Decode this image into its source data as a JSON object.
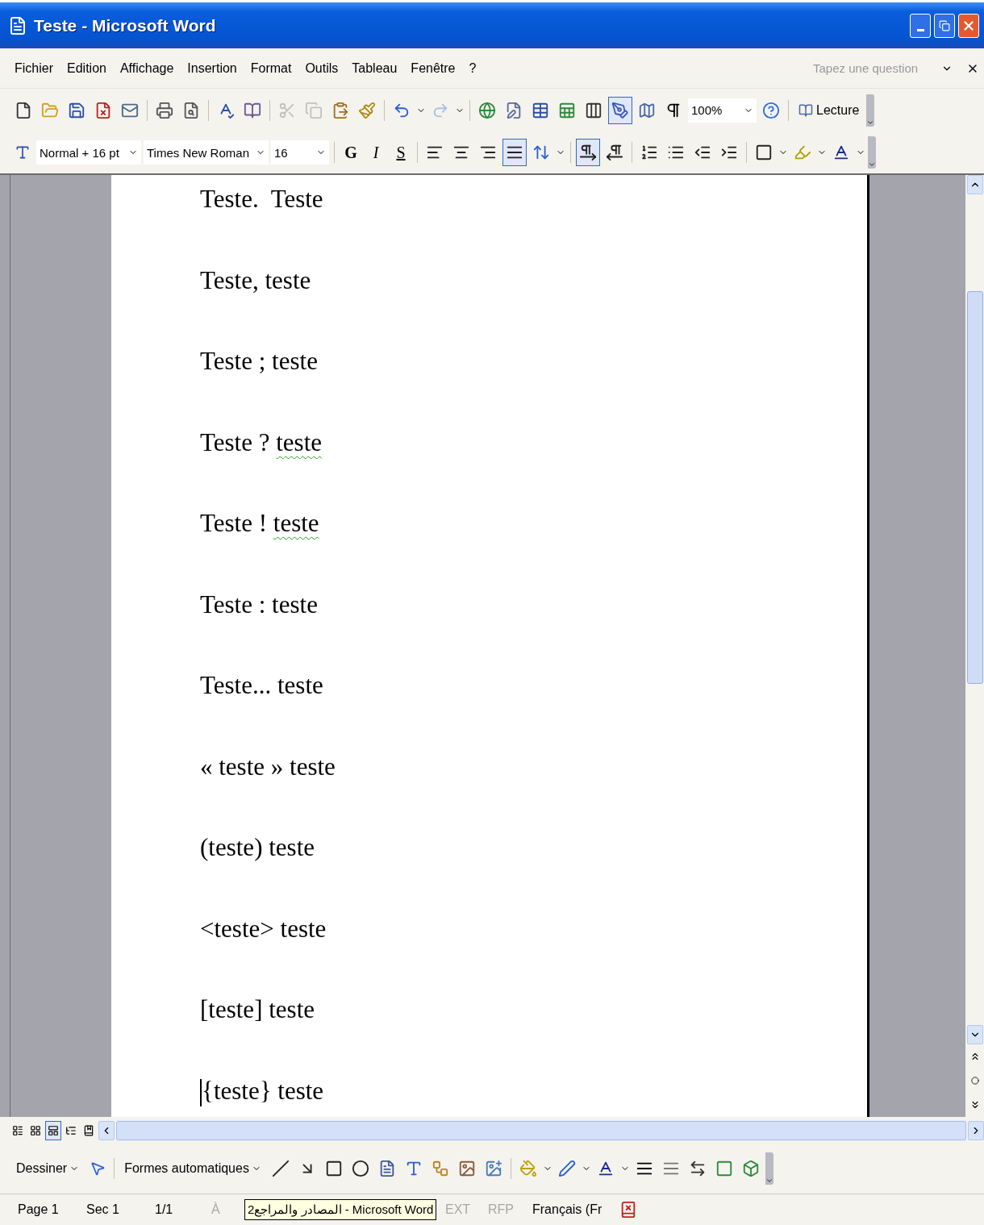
{
  "window": {
    "title": "Teste - Microsoft Word"
  },
  "menu_bar": {
    "items": [
      {
        "label": "Fichier"
      },
      {
        "label": "Edition"
      },
      {
        "label": "Affichage"
      },
      {
        "label": "Insertion"
      },
      {
        "label": "Format"
      },
      {
        "label": "Outils"
      },
      {
        "label": "Tableau"
      },
      {
        "label": "Fenêtre"
      },
      {
        "label": "?"
      }
    ],
    "question_placeholder": "Tapez une question"
  },
  "standard_toolbar": {
    "tools": [
      {
        "pressed": false,
        "disabled": false
      },
      {
        "pressed": false,
        "disabled": false
      },
      {
        "pressed": false,
        "disabled": false
      },
      {
        "pressed": false,
        "disabled": false
      },
      {
        "pressed": false,
        "disabled": false
      },
      {
        "pressed": false,
        "disabled": false
      },
      {
        "pressed": false,
        "disabled": false
      },
      {
        "pressed": false,
        "disabled": false
      },
      {
        "pressed": false,
        "disabled": false
      },
      {
        "pressed": false,
        "disabled": true
      },
      {
        "pressed": false,
        "disabled": true
      },
      {
        "pressed": false,
        "disabled": false
      },
      {
        "pressed": false,
        "disabled": false
      },
      {
        "pressed": false,
        "disabled": false
      },
      {
        "pressed": false,
        "disabled": true
      },
      {
        "pressed": false,
        "disabled": false
      },
      {
        "pressed": false,
        "disabled": false
      },
      {
        "pressed": false,
        "disabled": false
      },
      {
        "pressed": false,
        "disabled": false
      },
      {
        "pressed": false,
        "disabled": false
      },
      {
        "pressed": true,
        "disabled": false
      },
      {
        "pressed": false,
        "disabled": false
      },
      {
        "pressed": false,
        "disabled": false
      }
    ],
    "zoom": "100%",
    "reading_button": "Lecture"
  },
  "formatting_toolbar": {
    "style": "Normal + 16 pt",
    "font": "Times New Roman",
    "size": "16",
    "format_buttons": [
      {
        "label": "G",
        "pressed": false
      },
      {
        "label": "I",
        "pressed": false
      },
      {
        "label": "S",
        "pressed": false
      }
    ],
    "tools": [
      {
        "pressed": false
      },
      {
        "pressed": false
      },
      {
        "pressed": false
      },
      {
        "pressed": true
      },
      {
        "pressed": false
      },
      {
        "pressed": true
      },
      {
        "pressed": false
      },
      {
        "pressed": false
      },
      {
        "pressed": false
      },
      {
        "pressed": false
      },
      {
        "pressed": false
      },
      {
        "pressed": false
      },
      {
        "pressed": false
      },
      {
        "pressed": false
      }
    ]
  },
  "document": {
    "lines": [
      {
        "parts": [
          {
            "text": "Teste.  Teste",
            "spell_error": false
          }
        ],
        "cursor": false
      },
      {
        "parts": [
          {
            "text": "Teste, teste",
            "spell_error": false
          }
        ],
        "cursor": false
      },
      {
        "parts": [
          {
            "text": "Teste ; teste",
            "spell_error": false
          }
        ],
        "cursor": false
      },
      {
        "parts": [
          {
            "text": "Teste ? ",
            "spell_error": false
          },
          {
            "text": "teste",
            "spell_error": true
          }
        ],
        "cursor": false
      },
      {
        "parts": [
          {
            "text": "Teste ! ",
            "spell_error": false
          },
          {
            "text": "teste",
            "spell_error": true
          }
        ],
        "cursor": false
      },
      {
        "parts": [
          {
            "text": "Teste : teste",
            "spell_error": false
          }
        ],
        "cursor": false
      },
      {
        "parts": [
          {
            "text": "Teste... teste",
            "spell_error": false
          }
        ],
        "cursor": false
      },
      {
        "parts": [
          {
            "text": "« teste » teste",
            "spell_error": false
          }
        ],
        "cursor": false
      },
      {
        "parts": [
          {
            "text": "(teste) teste",
            "spell_error": false
          }
        ],
        "cursor": false
      },
      {
        "parts": [
          {
            "text": "<teste> teste",
            "spell_error": false
          }
        ],
        "cursor": false
      },
      {
        "parts": [
          {
            "text": "[teste] teste",
            "spell_error": false
          }
        ],
        "cursor": false
      },
      {
        "parts": [
          {
            "text": "{teste} teste",
            "spell_error": false
          }
        ],
        "cursor": true
      }
    ]
  },
  "view_buttons": [
    {
      "selected": false
    },
    {
      "selected": false
    },
    {
      "selected": true
    },
    {
      "selected": false
    },
    {
      "selected": false
    }
  ],
  "drawing_toolbar": {
    "draw_menu": "Dessiner",
    "autoshapes_menu": "Formes automatiques"
  },
  "status_bar": {
    "items": [
      {
        "text": "Page 1",
        "disabled": false
      },
      {
        "text": "Sec 1",
        "disabled": false
      },
      {
        "text": "1/1",
        "disabled": false
      },
      {
        "text": "À",
        "disabled": true
      },
      {
        "text": "EXT",
        "disabled": true
      },
      {
        "text": "RFP",
        "disabled": true
      },
      {
        "text": "Français (Fr",
        "disabled": false
      }
    ],
    "tooltip": "المصادر والمراجع2 - Microsoft Word"
  }
}
